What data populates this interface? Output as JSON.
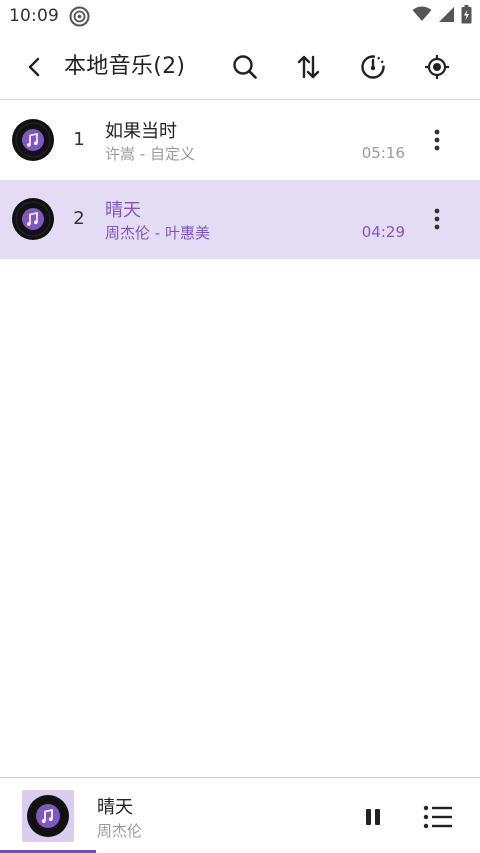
{
  "status_bar": {
    "time": "10:09"
  },
  "app_bar": {
    "title": "本地音乐(2)"
  },
  "songs": [
    {
      "index": "1",
      "title": "如果当时",
      "meta": "许嵩 - 自定义",
      "duration": "05:16",
      "active": false
    },
    {
      "index": "2",
      "title": "晴天",
      "meta": "周杰伦 - 叶惠美",
      "duration": "04:29",
      "active": true
    }
  ],
  "player": {
    "title": "晴天",
    "artist": "周杰伦",
    "progress": 0.2
  },
  "colors": {
    "accent": "#7e57c2",
    "active_row_bg": "#e4dcf2",
    "disc_label": "#7e57c2"
  },
  "icons": {
    "status": [
      "disc-icon",
      "wifi-icon",
      "signal-icon",
      "battery-icon"
    ],
    "toolbar": [
      "back-arrow-icon",
      "search-icon",
      "sort-icon",
      "timer-icon",
      "locate-icon"
    ],
    "row": [
      "album-disc-icon",
      "more-vert-icon"
    ],
    "player": [
      "music-note-icon",
      "pause-icon",
      "playlist-icon"
    ]
  }
}
